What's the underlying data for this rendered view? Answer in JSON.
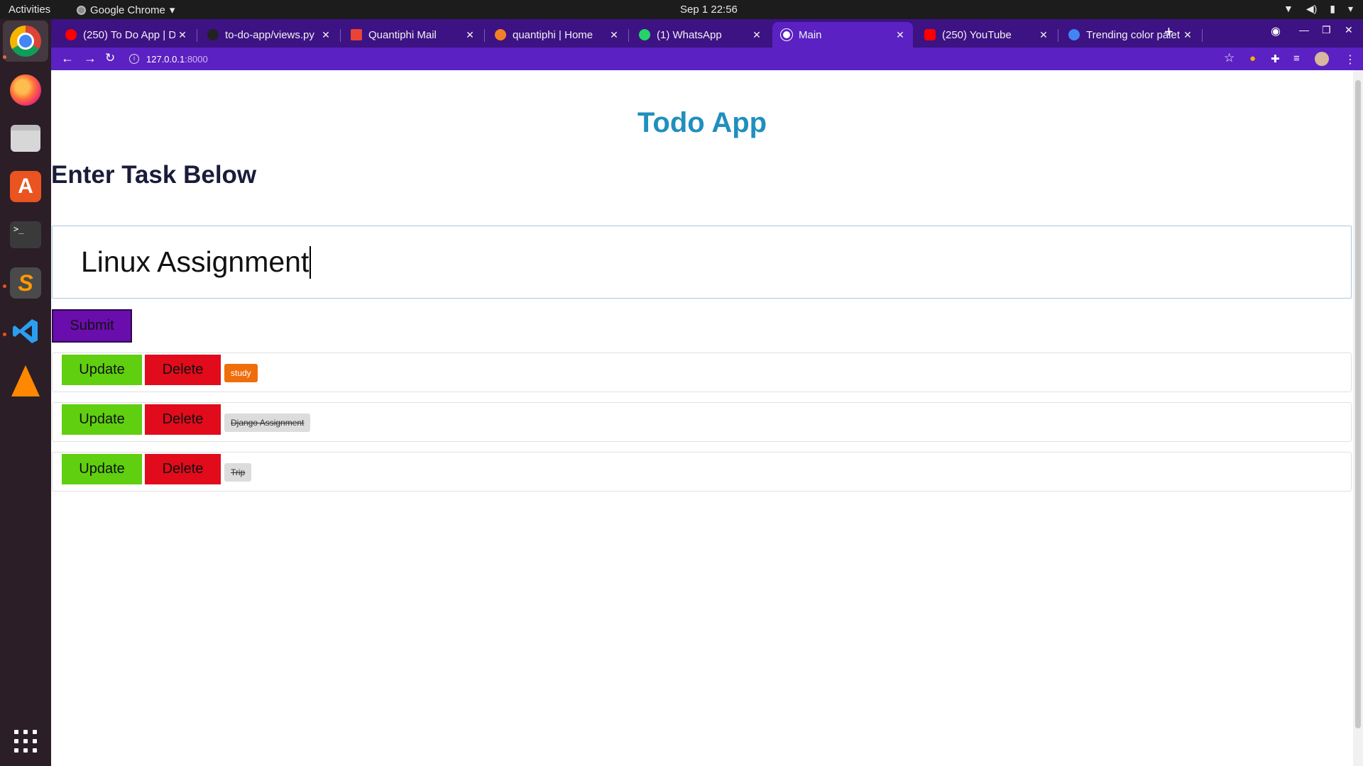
{
  "system": {
    "activities": "Activities",
    "app_name": "Google Chrome",
    "clock": "Sep 1  22:56"
  },
  "browser": {
    "tabs": [
      {
        "title": "(250) To Do App | Dj",
        "favicon_color": "#ff0000"
      },
      {
        "title": "to-do-app/views.py",
        "favicon_color": "#222222"
      },
      {
        "title": "Quantiphi Mail",
        "favicon_color": "#ea4335"
      },
      {
        "title": "quantiphi | Home",
        "favicon_color": "#f48024"
      },
      {
        "title": "(1) WhatsApp",
        "favicon_color": "#25d366"
      },
      {
        "title": "Main",
        "favicon_color": "#ffffff",
        "active": true
      },
      {
        "title": "(250) YouTube",
        "favicon_color": "#ff0000"
      },
      {
        "title": "Trending color palet",
        "favicon_color": "#4285f4"
      }
    ],
    "url_host": "127.0.0.1",
    "url_port": ":8000"
  },
  "page": {
    "app_title": "Todo App",
    "subtitle": "Enter Task Below",
    "input_value": "Linux Assignment",
    "submit_label": "Submit",
    "todos": [
      {
        "update_label": "Update",
        "delete_label": "Delete",
        "task": "study",
        "completed": false
      },
      {
        "update_label": "Update",
        "delete_label": "Delete",
        "task": "Django Assignment",
        "completed": true
      },
      {
        "update_label": "Update",
        "delete_label": "Delete",
        "task": "Trip",
        "completed": true
      }
    ]
  },
  "colors": {
    "title": "#1f8fbf",
    "submit": "#6a0dad",
    "update": "#5fcf10",
    "delete": "#e10b1c",
    "pending_badge": "#f06d0c",
    "done_badge": "#dcdcdc",
    "browser_frame": "#3d1283"
  }
}
